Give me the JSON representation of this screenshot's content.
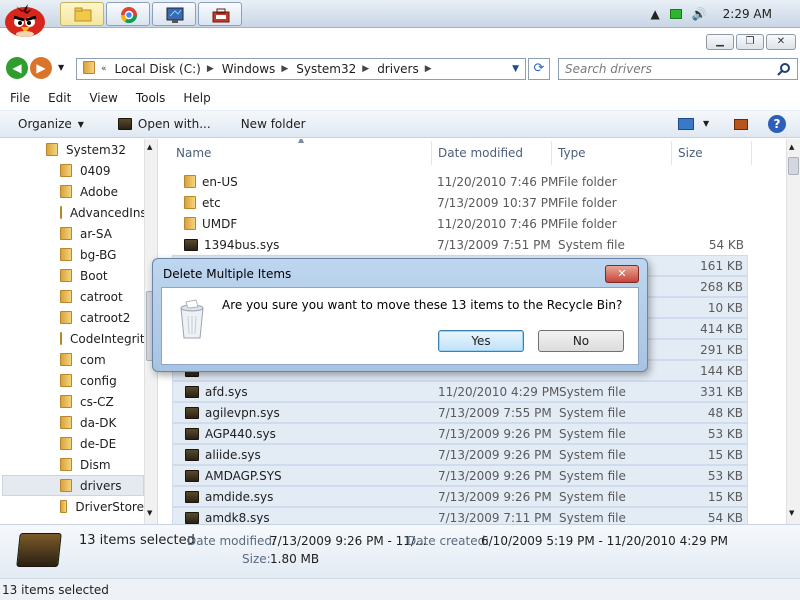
{
  "taskbar": {
    "clock": "2:29 AM",
    "buttons": [
      "explorer",
      "chrome",
      "display",
      "network"
    ]
  },
  "address": {
    "crumbs": [
      "Local Disk (C:)",
      "Windows",
      "System32",
      "drivers"
    ],
    "search_placeholder": "Search drivers"
  },
  "menu": [
    "File",
    "Edit",
    "View",
    "Tools",
    "Help"
  ],
  "toolbar": {
    "organize": "Organize",
    "open_with": "Open with...",
    "new_folder": "New folder"
  },
  "nav": {
    "items": [
      {
        "label": "System32"
      },
      {
        "label": "0409"
      },
      {
        "label": "Adobe"
      },
      {
        "label": "AdvancedInstallers"
      },
      {
        "label": "ar-SA"
      },
      {
        "label": "bg-BG"
      },
      {
        "label": "Boot"
      },
      {
        "label": "catroot"
      },
      {
        "label": "catroot2"
      },
      {
        "label": "CodeIntegrity"
      },
      {
        "label": "com"
      },
      {
        "label": "config"
      },
      {
        "label": "cs-CZ"
      },
      {
        "label": "da-DK"
      },
      {
        "label": "de-DE"
      },
      {
        "label": "Dism"
      },
      {
        "label": "drivers"
      },
      {
        "label": "DriverStore"
      }
    ]
  },
  "columns": {
    "name": "Name",
    "date": "Date modified",
    "type": "Type",
    "size": "Size"
  },
  "rows": [
    {
      "name": "en-US",
      "date": "11/20/2010 7:46 PM",
      "type": "File folder",
      "size": "",
      "icon": "folder",
      "selected": false
    },
    {
      "name": "etc",
      "date": "7/13/2009 10:37 PM",
      "type": "File folder",
      "size": "",
      "icon": "folder",
      "selected": false
    },
    {
      "name": "UMDF",
      "date": "11/20/2010 7:46 PM",
      "type": "File folder",
      "size": "",
      "icon": "folder",
      "selected": false
    },
    {
      "name": "1394bus.sys",
      "date": "7/13/2009 7:51 PM",
      "type": "System file",
      "size": "54 KB",
      "icon": "sys",
      "selected": false
    },
    {
      "name": "",
      "date": "",
      "type": "",
      "size": "161 KB",
      "icon": "sys",
      "selected": true
    },
    {
      "name": "",
      "date": "",
      "type": "",
      "size": "268 KB",
      "icon": "sys",
      "selected": true
    },
    {
      "name": "",
      "date": "",
      "type": "",
      "size": "10 KB",
      "icon": "sys",
      "selected": true
    },
    {
      "name": "",
      "date": "",
      "type": "",
      "size": "414 KB",
      "icon": "sys",
      "selected": true
    },
    {
      "name": "",
      "date": "",
      "type": "",
      "size": "291 KB",
      "icon": "sys",
      "selected": true
    },
    {
      "name": "",
      "date": "",
      "type": "",
      "size": "144 KB",
      "icon": "sys",
      "selected": true
    },
    {
      "name": "afd.sys",
      "date": "11/20/2010 4:29 PM",
      "type": "System file",
      "size": "331 KB",
      "icon": "sys",
      "selected": true
    },
    {
      "name": "agilevpn.sys",
      "date": "7/13/2009 7:55 PM",
      "type": "System file",
      "size": "48 KB",
      "icon": "sys",
      "selected": true
    },
    {
      "name": "AGP440.sys",
      "date": "7/13/2009 9:26 PM",
      "type": "System file",
      "size": "53 KB",
      "icon": "sys",
      "selected": true
    },
    {
      "name": "aliide.sys",
      "date": "7/13/2009 9:26 PM",
      "type": "System file",
      "size": "15 KB",
      "icon": "sys",
      "selected": true
    },
    {
      "name": "AMDAGP.SYS",
      "date": "7/13/2009 9:26 PM",
      "type": "System file",
      "size": "53 KB",
      "icon": "sys",
      "selected": true
    },
    {
      "name": "amdide.sys",
      "date": "7/13/2009 9:26 PM",
      "type": "System file",
      "size": "15 KB",
      "icon": "sys",
      "selected": true
    },
    {
      "name": "amdk8.sys",
      "date": "7/13/2009 7:11 PM",
      "type": "System file",
      "size": "54 KB",
      "icon": "sys",
      "selected": true
    }
  ],
  "details": {
    "count": "13 items selected",
    "date_modified_label": "Date modified:",
    "date_modified": "7/13/2009 9:26 PM - 11/...",
    "date_created_label": "Date created:",
    "date_created": "6/10/2009 5:19 PM - 11/20/2010 4:29 PM",
    "size_label": "Size:",
    "size": "1.80 MB"
  },
  "status": "13 items selected",
  "dialog": {
    "title": "Delete Multiple Items",
    "close": "✕",
    "message": "Are you sure you want to move these 13 items to the Recycle Bin?",
    "yes": "Yes",
    "no": "No"
  }
}
